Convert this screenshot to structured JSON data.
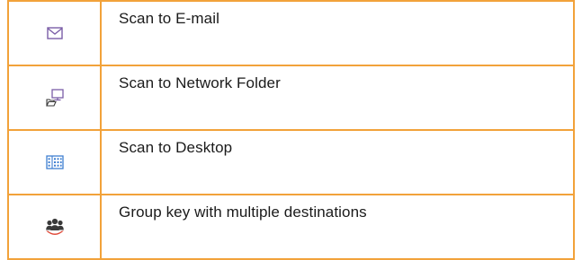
{
  "colors": {
    "border": "#F2A23A",
    "icon_purple": "#7B5EA7",
    "icon_blue": "#3F7FD1",
    "icon_red": "#E04B3A",
    "icon_dark": "#3A3A3A"
  },
  "rows": [
    {
      "icon": "envelope-icon",
      "label": "Scan to E-mail"
    },
    {
      "icon": "network-folder-icon",
      "label": "Scan to Network Folder"
    },
    {
      "icon": "desktop-grid-icon",
      "label": "Scan to Desktop"
    },
    {
      "icon": "group-people-icon",
      "label": "Group key with multiple destinations"
    }
  ]
}
